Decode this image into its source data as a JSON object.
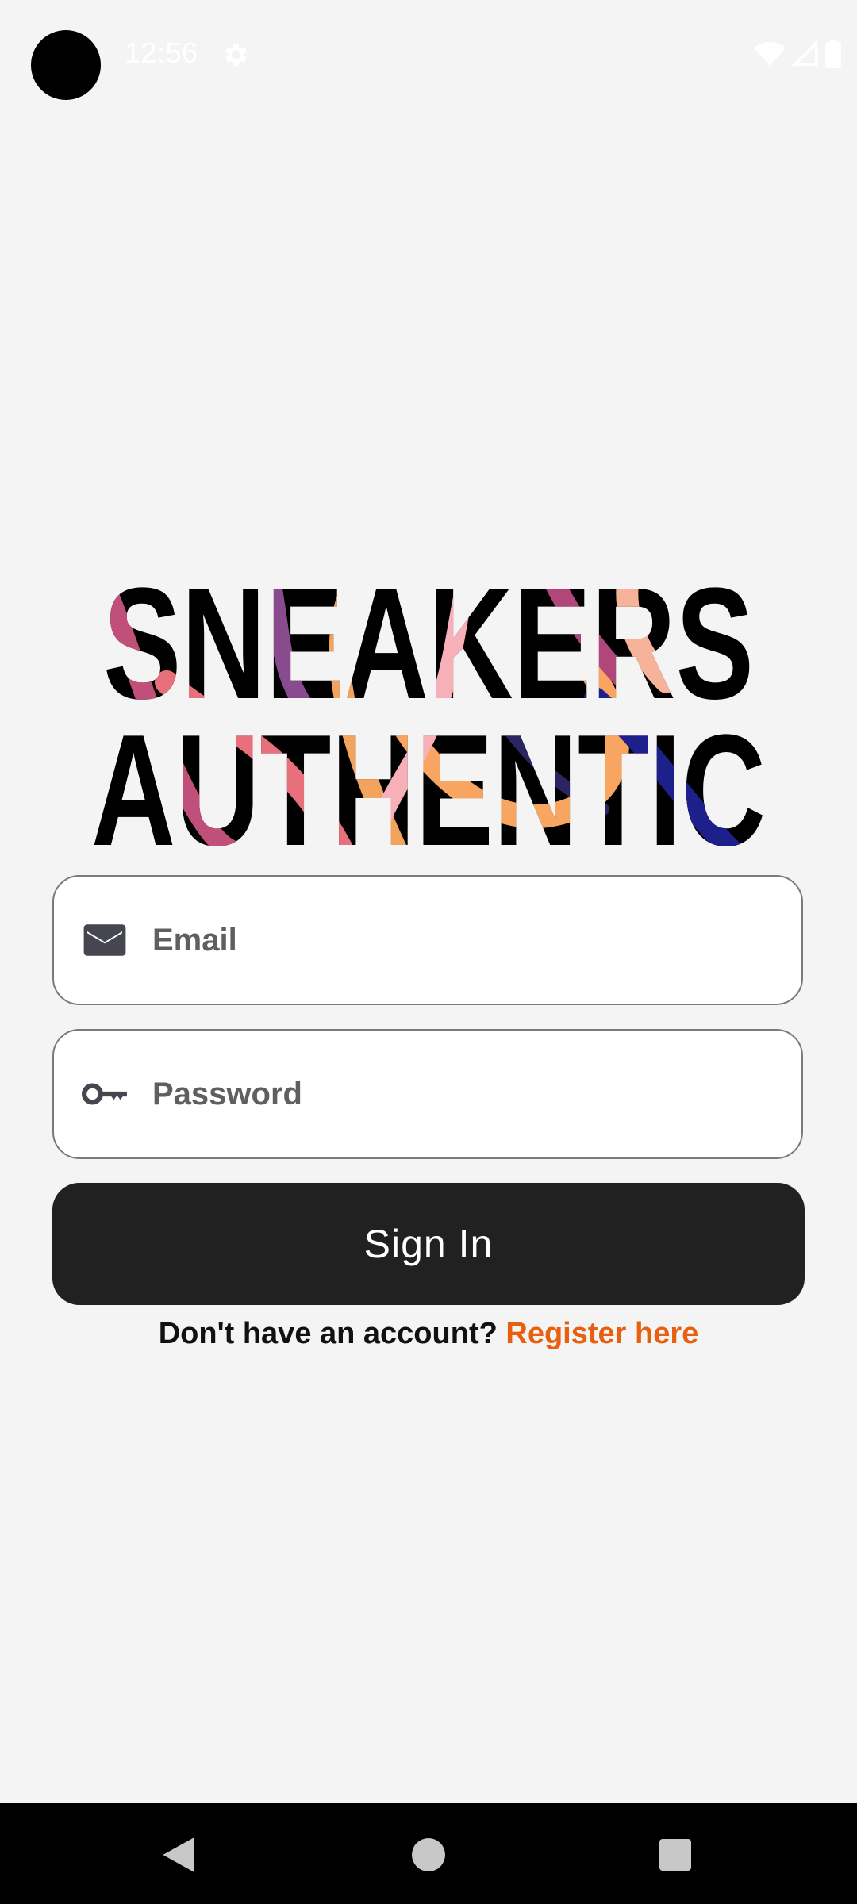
{
  "status_bar": {
    "time": "12:56",
    "icons": [
      "settings-gear-icon",
      "wifi-icon",
      "cell-signal-icon",
      "battery-icon"
    ]
  },
  "logo": {
    "line1": "SNEAKERS",
    "line2": "AUTHENTIC"
  },
  "form": {
    "email_placeholder": "Email",
    "email_icon": "mail-icon",
    "password_placeholder": "Password",
    "password_icon": "key-icon",
    "signin_label": "Sign In"
  },
  "register": {
    "prompt": "Don't have an account?",
    "link_label": "Register here"
  },
  "nav": {
    "buttons": [
      "back-icon",
      "home-icon",
      "recents-icon"
    ]
  },
  "colors": {
    "background": "#f4f4f4",
    "button": "#212121",
    "link": "#e85f10"
  }
}
